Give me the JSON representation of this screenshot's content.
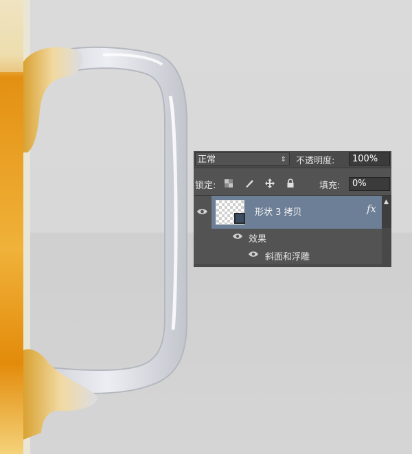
{
  "layers_panel": {
    "blend_mode": "正常",
    "opacity_label": "不透明度:",
    "opacity_value": "100%",
    "lock_label": "锁定:",
    "fill_label": "填充:",
    "fill_value": "0%",
    "layer": {
      "name": "形状 3 拷贝",
      "fx_label": "fx"
    },
    "effects_label": "效果",
    "effect_items": [
      "斜面和浮雕"
    ]
  },
  "colors": {
    "panel_bg": "#535353",
    "selected_layer": "#6c7f97",
    "beer": "#e8a012",
    "glass_handle": "#d9dbe2"
  }
}
